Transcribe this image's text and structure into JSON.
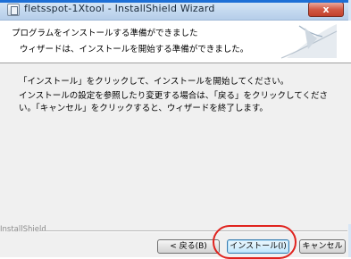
{
  "window": {
    "title": "fletsspot-1Xtool - InstallShield Wizard",
    "close_label": "x"
  },
  "header": {
    "title": "プログラムをインストールする準備ができました",
    "subtitle": "ウィザードは、インストールを開始する準備ができました。"
  },
  "content": {
    "paragraph1": "「インストール」をクリックして、インストールを開始してください。",
    "paragraph2": "インストールの設定を参照したり変更する場合は、「戻る」をクリックしてください。「キャンセル」をクリックすると、ウィザードを終了します。"
  },
  "footer": {
    "brand": "InstallShield",
    "back_label": "< 戻る(B)",
    "install_label": "インストール(I)",
    "cancel_label": "キャンセル"
  },
  "colors": {
    "highlight": "#e0231e",
    "titlebar": "#c4d9ef"
  }
}
